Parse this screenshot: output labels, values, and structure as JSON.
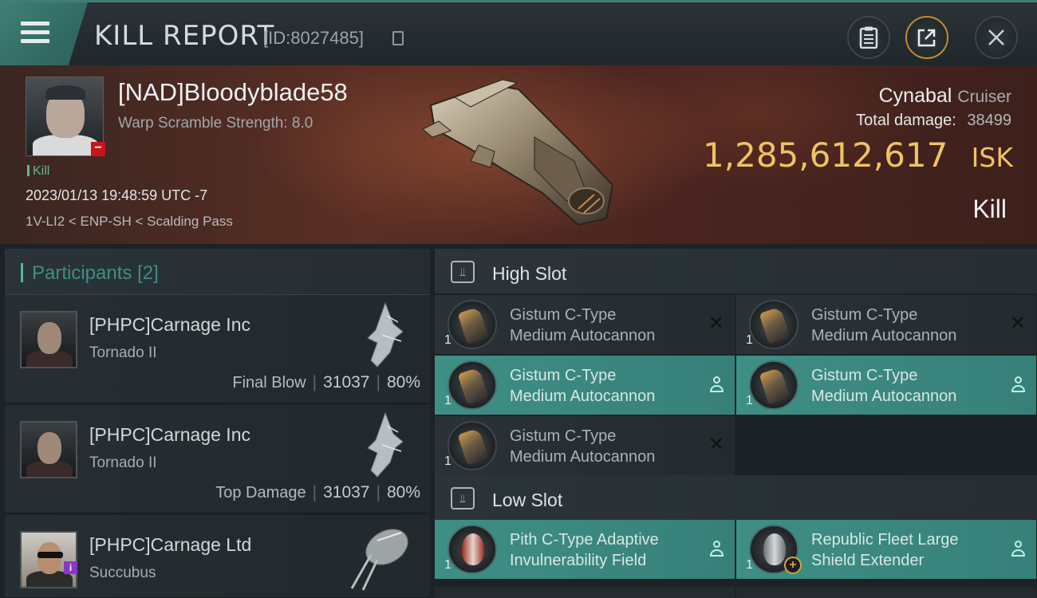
{
  "header": {
    "title": "KILL REPORT",
    "id_label": "[ID:8027485]",
    "menu_icon": "hamburger-menu-icon",
    "buttons": [
      {
        "name": "clipboard-button",
        "icon": "clipboard-icon"
      },
      {
        "name": "share-button",
        "icon": "share-icon"
      },
      {
        "name": "close-button",
        "icon": "close-icon"
      }
    ]
  },
  "victim": {
    "name": "[NAD]Bloodyblade58",
    "scramble": "Warp Scramble Strength: 8.0",
    "tag": "Kill",
    "datetime": "2023/01/13 19:48:59 UTC -7",
    "location": "1V-LI2 < ENP-SH < Scalding Pass",
    "ship": "Cynabal",
    "ship_class": "Cruiser",
    "total_damage_label": "Total damage:",
    "total_damage": "38499",
    "isk_value": "1,285,612,617",
    "isk_unit": "ISK",
    "result": "Kill"
  },
  "participants": {
    "label": "Participants",
    "count": "[2]",
    "rows": [
      {
        "name": "[PHPC]Carnage Inc",
        "ship": "Tornado II",
        "label": "Final Blow",
        "damage": "31037",
        "percent": "80%"
      },
      {
        "name": "[PHPC]Carnage Inc",
        "ship": "Tornado II",
        "label": "Top Damage",
        "damage": "31037",
        "percent": "80%"
      },
      {
        "name": "[PHPC]Carnage Ltd",
        "ship": "Succubus"
      }
    ]
  },
  "fitting": {
    "high_slot": {
      "title": "High Slot",
      "modules": [
        {
          "qty": "1",
          "line1": "Gistum C-Type",
          "line2": "Medium Autocannon",
          "status": "destroyed"
        },
        {
          "qty": "1",
          "line1": "Gistum C-Type",
          "line2": "Medium Autocannon",
          "status": "destroyed"
        },
        {
          "qty": "1",
          "line1": "Gistum C-Type",
          "line2": "Medium Autocannon",
          "status": "dropped"
        },
        {
          "qty": "1",
          "line1": "Gistum C-Type",
          "line2": "Medium Autocannon",
          "status": "dropped"
        },
        {
          "qty": "1",
          "line1": "Gistum C-Type",
          "line2": "Medium Autocannon",
          "status": "destroyed"
        }
      ]
    },
    "low_slot": {
      "title": "Low Slot",
      "modules": [
        {
          "qty": "1",
          "line1": "Pith C-Type Adaptive",
          "line2": "Invulnerability Field",
          "status": "dropped"
        },
        {
          "qty": "1",
          "line1": "Republic Fleet Large",
          "line2": "Shield Extender",
          "status": "dropped"
        }
      ]
    }
  },
  "colors": {
    "accent_teal": "#3e8f86",
    "isk_gold": "#f0c264",
    "badge_red": "#c8141b"
  }
}
